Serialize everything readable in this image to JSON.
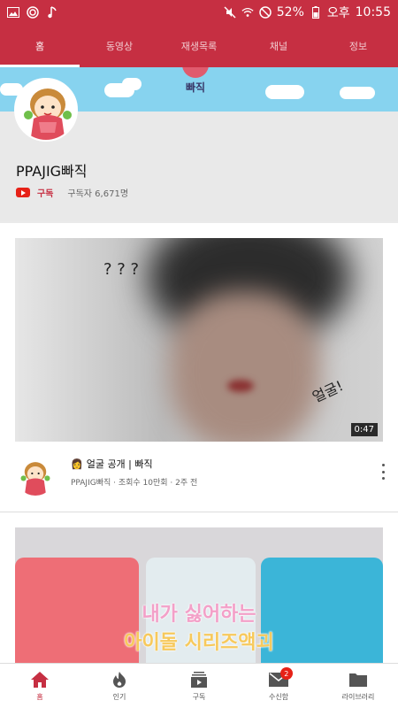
{
  "status_bar": {
    "battery": "52%",
    "ampm": "오후",
    "time": "10:55",
    "left_icons": [
      "image-icon",
      "app-icon",
      "music-note-icon"
    ],
    "right_icons": [
      "mute-icon",
      "wifi-icon",
      "no-disturb-icon",
      "battery-icon"
    ]
  },
  "tabs": [
    {
      "label": "홈",
      "active": true
    },
    {
      "label": "동영상",
      "active": false
    },
    {
      "label": "재생목록",
      "active": false
    },
    {
      "label": "채널",
      "active": false
    },
    {
      "label": "정보",
      "active": false
    }
  ],
  "channel": {
    "banner_text": "빠직",
    "name": "PPAJIG빠직",
    "subscribe_label": "구독",
    "subscriber_count": "구독자 6,671명"
  },
  "videos": [
    {
      "overlay_marks": "? ? ?",
      "overlay_text": "얼굴!",
      "duration": "0:47",
      "title_emoji": "👩",
      "title": "얼굴 공개 | 빠직",
      "subtitle": "PPAJIG빠직 · 조회수 10만회 · 2주 전"
    },
    {
      "overlay_line1": "내가 싫어하는",
      "overlay_line2": "아이돌 시리즈액괴"
    }
  ],
  "bottom_nav": [
    {
      "label": "홈",
      "icon": "home-icon",
      "active": true
    },
    {
      "label": "인기",
      "icon": "flame-icon",
      "active": false
    },
    {
      "label": "구독",
      "icon": "subscriptions-icon",
      "active": false
    },
    {
      "label": "수신함",
      "icon": "inbox-icon",
      "active": false,
      "badge": "2"
    },
    {
      "label": "라이브러리",
      "icon": "folder-icon",
      "active": false
    }
  ],
  "colors": {
    "brand_red": "#c62f42",
    "banner_blue": "#87d3ef"
  }
}
